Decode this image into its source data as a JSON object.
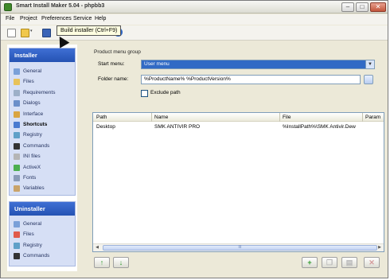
{
  "window": {
    "title": "Smart Install Maker 5.04 - phpbb3"
  },
  "titlebar_buttons": {
    "min": "–",
    "max": "□",
    "close": "✕"
  },
  "menu": [
    "File",
    "Project",
    "Preferences",
    "Service",
    "Help"
  ],
  "toolbar": {
    "tooltip": "Build installer (Ctrl+F9)",
    "help": "?"
  },
  "sidebar": {
    "installer": {
      "title": "Installer",
      "items": [
        "General",
        "Files",
        "Requirements",
        "Dialogs",
        "Interface",
        "Shortcuts",
        "Registry",
        "Commands",
        "INI files",
        "ActiveX",
        "Fonts",
        "Variables"
      ],
      "active": "Shortcuts"
    },
    "uninstaller": {
      "title": "Uninstaller",
      "items": [
        "General",
        "Files",
        "Registry",
        "Commands"
      ]
    }
  },
  "form": {
    "group_label": "Product menu group",
    "start_menu_label": "Start menu:",
    "start_menu_value": "User menu",
    "folder_name_label": "Folder name:",
    "folder_name_value": "%ProductName% %ProductVersion%",
    "exclude_path_label": "Exclude path",
    "exclude_path_checked": false
  },
  "table": {
    "columns": [
      "Path",
      "Name",
      "File",
      "Param"
    ],
    "rows": [
      {
        "path": "Desktop",
        "name": "SMK ANTIVIR PRO",
        "file": "%InstallPath%\\SMK Antivir.Dew",
        "param": ""
      }
    ],
    "scroll_grip": "III"
  },
  "bottom_buttons": {
    "up": "↑",
    "down": "↓",
    "add": "+",
    "duplicate": "❐",
    "edit": "▤",
    "delete": "✕"
  },
  "colors": {
    "sidebar_header": "#2553b3",
    "panel_bg": "#d6dff5",
    "selection": "#316ac5"
  }
}
